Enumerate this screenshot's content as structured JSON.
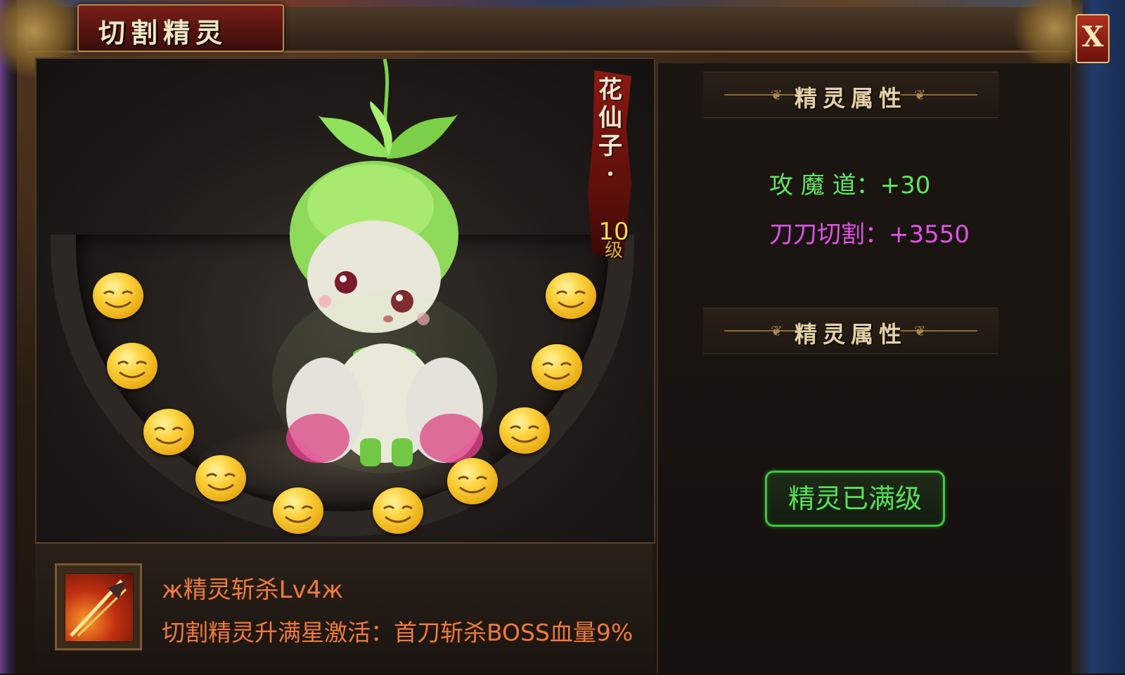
{
  "window": {
    "title": "切割精灵",
    "close_label": "X"
  },
  "spirit": {
    "name_chars": [
      "花",
      "仙",
      "子",
      "·"
    ],
    "level": "10",
    "level_unit": "级",
    "stars_lit": 10,
    "stars_total": 10
  },
  "attributes": {
    "section1_title": "精灵属性",
    "section2_title": "精灵属性",
    "lines": [
      {
        "label": "攻 魔 道：",
        "value": "+30",
        "color": "#5ee85e"
      },
      {
        "label": "刀刀切割：",
        "value": "+3550",
        "color": "#e052e8"
      }
    ]
  },
  "max_level_button": "精灵已满级",
  "skill": {
    "name": "ж精灵斩杀Lv4ж",
    "description": "切割精灵升满星激活：首刀斩杀BOSS血量9%"
  }
}
